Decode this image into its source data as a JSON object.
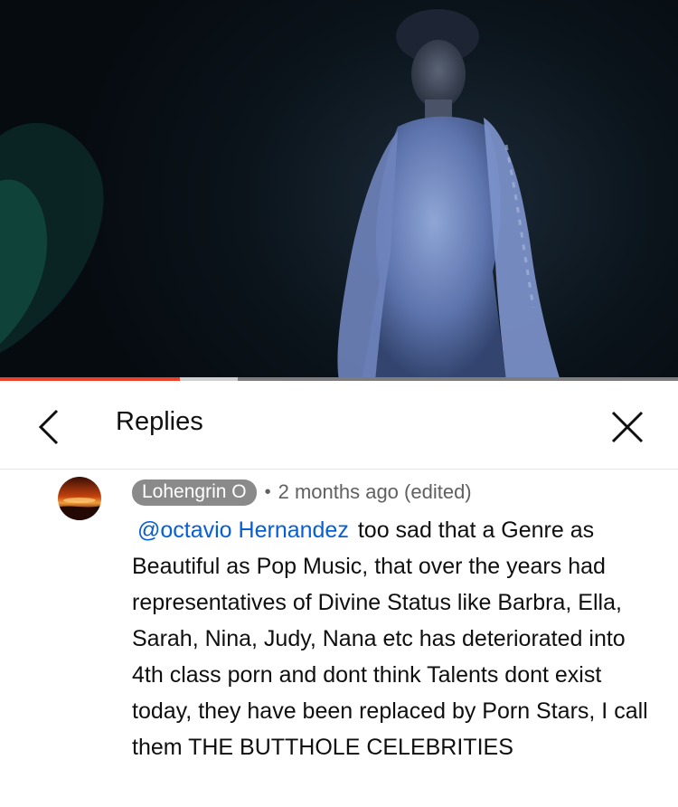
{
  "video": {
    "progress_played_pct": 26.5,
    "progress_buffered_pct": 35
  },
  "header": {
    "title": "Replies",
    "back_icon": "chevron-left-icon",
    "close_icon": "close-icon"
  },
  "comment": {
    "author": "Lohengrin O",
    "separator": "•",
    "time": "2 months ago (edited)",
    "mention": "@octavio Hernandez",
    "text": "too sad that a Genre as Beautiful as Pop Music, that over the years had representatives of Divine Status like Barbra, Ella, Sarah, Nina, Judy, Nana etc has deteriorated into 4th class porn and dont think Talents dont exist today, they have been replaced by Porn Stars, I call them THE BUTTHOLE CELEBRITIES"
  },
  "colors": {
    "progress_red": "#e8412c",
    "mention_blue": "#065fd4",
    "author_chip": "#8a8a8a"
  }
}
